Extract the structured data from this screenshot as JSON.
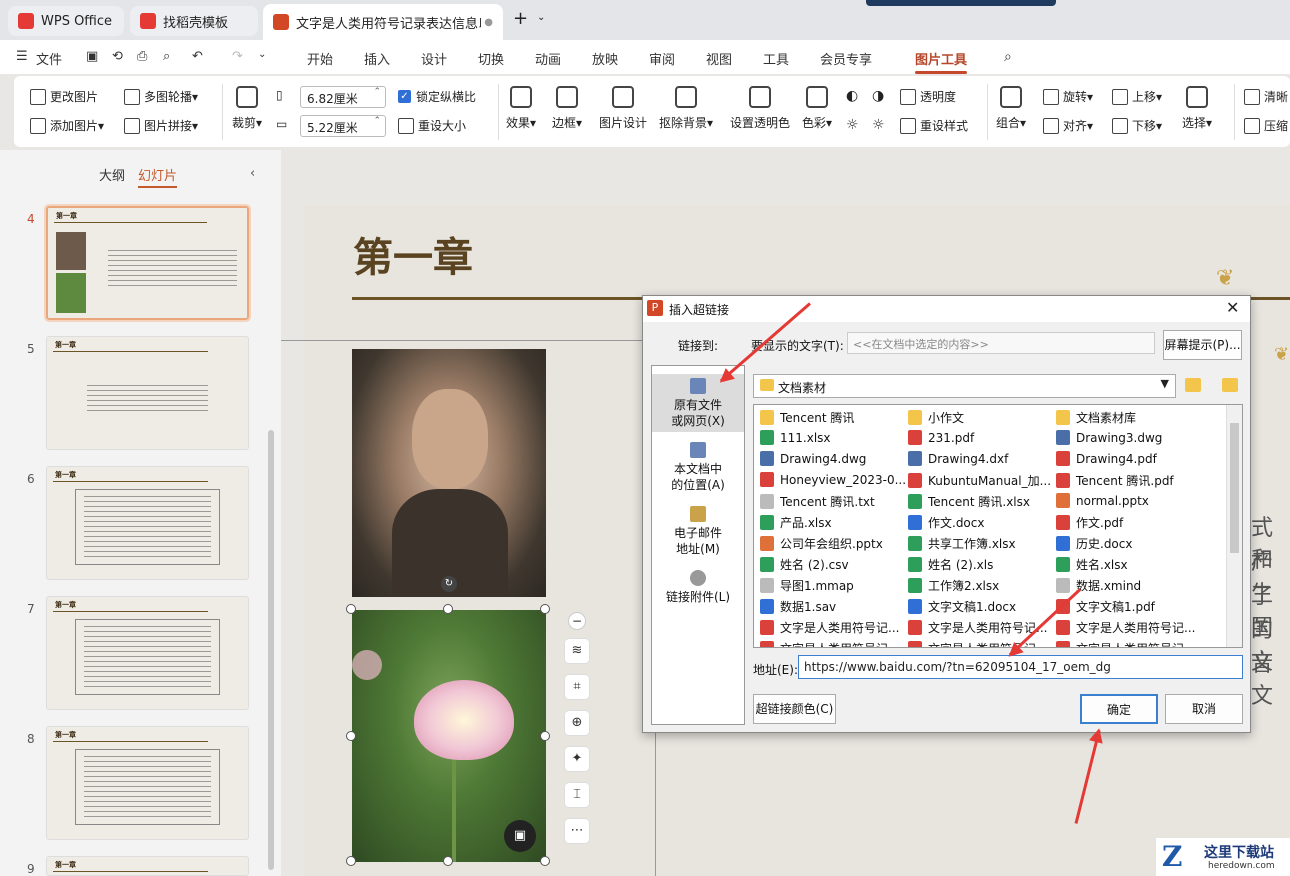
{
  "tabs": [
    {
      "label": "WPS Office",
      "color": "#e53935"
    },
    {
      "label": "找稻壳模板",
      "color": "#e53935"
    },
    {
      "label": "文字是人类用符号记录表达信息以",
      "color": "#d24726"
    }
  ],
  "menu": {
    "file": "文件",
    "items": [
      "开始",
      "插入",
      "设计",
      "切换",
      "动画",
      "放映",
      "审阅",
      "视图",
      "工具",
      "会员专享",
      "图片工具"
    ],
    "active": "图片工具"
  },
  "ribbon": {
    "change_pic": "更改图片",
    "add_pic": "添加图片",
    "multi_carousel": "多图轮播",
    "pic_stitch": "图片拼接",
    "crop": "裁剪",
    "width": "6.82厘米",
    "height": "5.22厘米",
    "lock_ratio": "锁定纵横比",
    "reset_size": "重设大小",
    "effect": "效果",
    "border": "边框",
    "pic_design": "图片设计",
    "remove_bg": "抠除背景",
    "set_transparent": "设置透明色",
    "color": "色彩",
    "transparency": "透明度",
    "reset_style": "重设样式",
    "group": "组合",
    "rotate": "旋转",
    "align": "对齐",
    "bring_up": "上移",
    "send_down": "下移",
    "select": "选择",
    "clear": "清晰",
    "compress": "压缩"
  },
  "panel": {
    "tab_outline": "大纲",
    "tab_slides": "幻灯片",
    "slides": [
      {
        "num": "4",
        "title": "第一章",
        "active": true
      },
      {
        "num": "5",
        "title": "第一章"
      },
      {
        "num": "6",
        "title": "第一章"
      },
      {
        "num": "7",
        "title": "第一章"
      },
      {
        "num": "8",
        "title": "第一章"
      },
      {
        "num": "9",
        "title": "第一章"
      }
    ]
  },
  "slide": {
    "title": "第一章",
    "side_text": [
      "式和",
      "产生",
      "了国",
      "的文",
      "音文"
    ]
  },
  "dialog": {
    "title": "插入超链接",
    "link_to": "链接到:",
    "display_text_label": "要显示的文字(T):",
    "display_text_placeholder": "<<在文档中选定的内容>>",
    "screen_tip": "屏幕提示(P)...",
    "folder": "文档素材",
    "link_options": [
      "原有文件\n或网页(X)",
      "本文档中\n的位置(A)",
      "电子邮件\n地址(M)",
      "链接附件(L)"
    ],
    "files": [
      [
        "Tencent 腾讯",
        "111.xlsx",
        "Drawing4.dwg",
        "Honeyview_2023-0...",
        "Tencent 腾讯.txt",
        "产品.xlsx",
        "公司年会组织.pptx",
        "姓名 (2).csv",
        "导图1.mmap",
        "数据1.sav",
        "文字是人类用符号记...",
        "文字是人类用符号记..."
      ],
      [
        "小作文",
        "231.pdf",
        "Drawing4.dxf",
        "KubuntuManual_加...",
        "Tencent 腾讯.xlsx",
        "作文.docx",
        "共享工作簿.xlsx",
        "姓名 (2).xls",
        "工作簿2.xlsx",
        "文字文稿1.docx",
        "文字是人类用符号记...",
        "文字是人类用符号记..."
      ],
      [
        "文档素材库",
        "Drawing3.dwg",
        "Drawing4.pdf",
        "Tencent 腾讯.pdf",
        "normal.pptx",
        "作文.pdf",
        "历史.docx",
        "姓名.xlsx",
        "数据.xmind",
        "文字文稿1.pdf",
        "文字是人类用符号记...",
        "文字是人类用符号记..."
      ]
    ],
    "address_label": "地址(E):",
    "address": "https://www.baidu.com/?tn=62095104_17_oem_dg",
    "link_color": "超链接颜色(C)",
    "ok": "确定",
    "cancel": "取消"
  },
  "watermark": {
    "text": "这里下载站",
    "url": "heredown.com"
  }
}
